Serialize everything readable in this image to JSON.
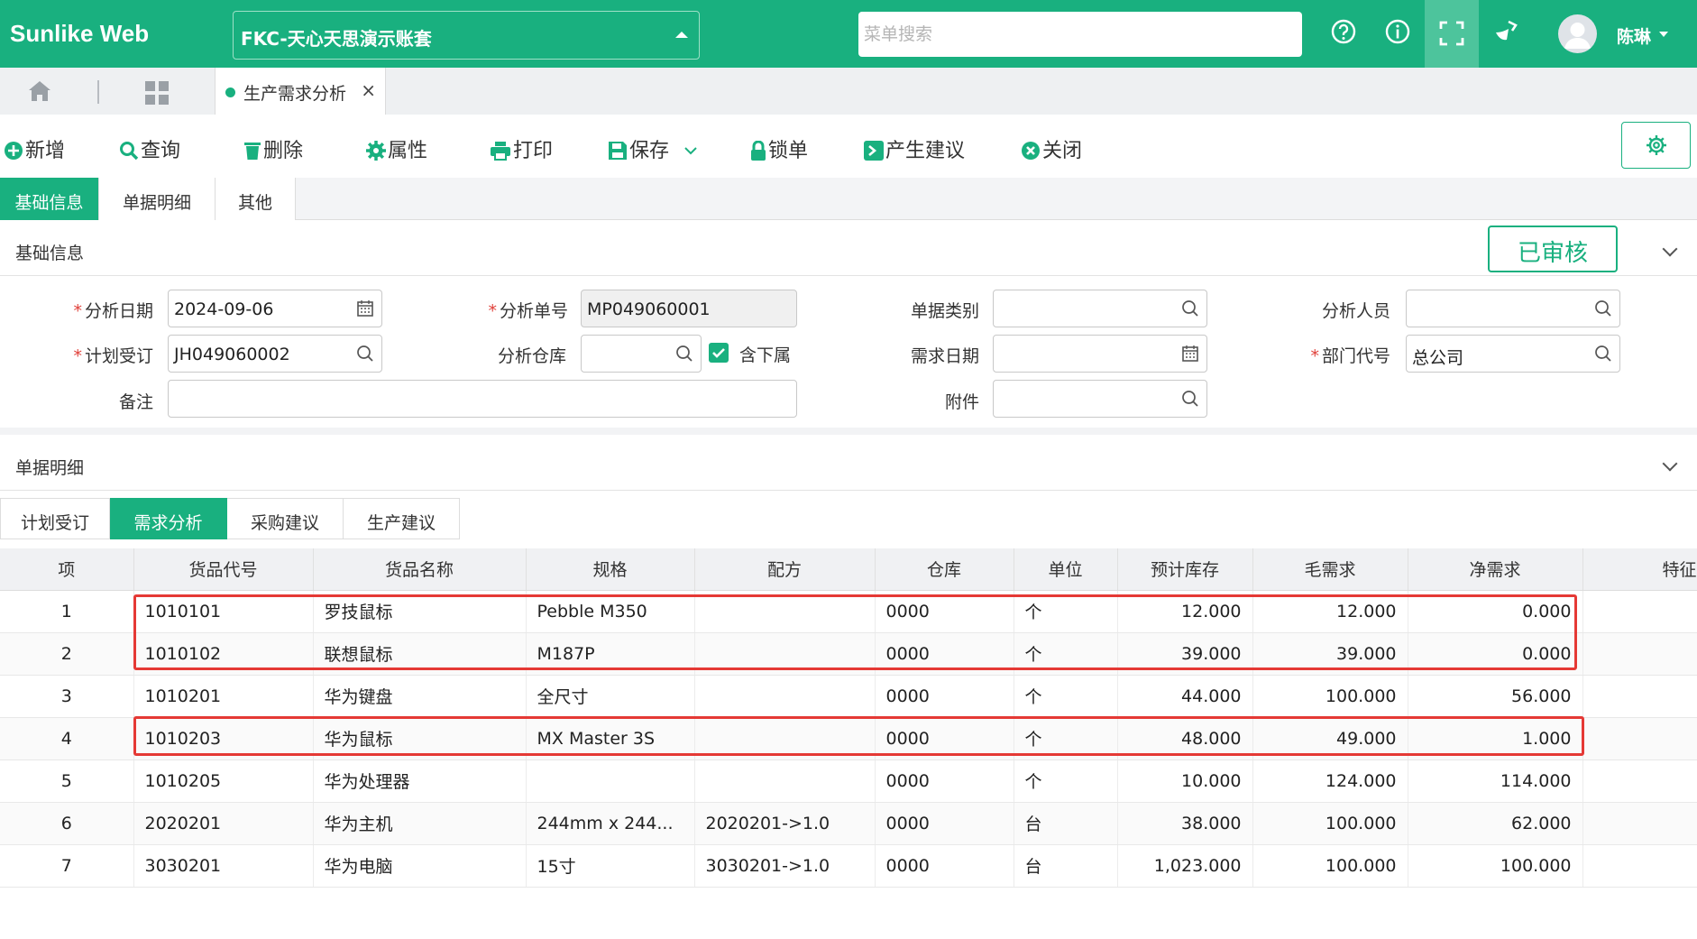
{
  "app": {
    "logo": "Sunlike Web",
    "account": "FKC-天心天思演示账套",
    "search_placeholder": "菜单搜索",
    "user": "陈琳"
  },
  "tabs": {
    "page_tab": "生产需求分析"
  },
  "toolbar": {
    "add": "新增",
    "query": "查询",
    "delete": "删除",
    "props": "属性",
    "print": "打印",
    "save": "保存",
    "lock": "锁单",
    "suggest": "产生建议",
    "close": "关闭"
  },
  "section_tabs": [
    "基础信息",
    "单据明细",
    "其他"
  ],
  "basic": {
    "title": "基础信息",
    "status": "已审核",
    "labels": {
      "date": "分析日期",
      "no": "分析单号",
      "type": "单据类别",
      "person": "分析人员",
      "plan": "计划受订",
      "wh": "分析仓库",
      "include_sub": "含下属",
      "req_date": "需求日期",
      "dept": "部门代号",
      "remark": "备注",
      "attach": "附件"
    },
    "values": {
      "date": "2024-09-06",
      "no": "MP049060001",
      "type": "",
      "person": "",
      "plan": "JH049060002",
      "wh": "",
      "req_date": "",
      "dept": "总公司",
      "remark": "",
      "attach": ""
    },
    "include_sub_checked": true
  },
  "detail": {
    "title": "单据明细",
    "tabs": [
      "计划受订",
      "需求分析",
      "采购建议",
      "生产建议"
    ],
    "active_tab": 1,
    "columns": [
      "项",
      "货品代号",
      "货品名称",
      "规格",
      "配方",
      "仓库",
      "单位",
      "预计库存",
      "毛需求",
      "净需求",
      "特征"
    ],
    "rows": [
      [
        "1",
        "1010101",
        "罗技鼠标",
        "Pebble M350",
        "",
        "0000",
        "个",
        "12.000",
        "12.000",
        "0.000",
        ""
      ],
      [
        "2",
        "1010102",
        "联想鼠标",
        "M187P",
        "",
        "0000",
        "个",
        "39.000",
        "39.000",
        "0.000",
        ""
      ],
      [
        "3",
        "1010201",
        "华为键盘",
        "全尺寸",
        "",
        "0000",
        "个",
        "44.000",
        "100.000",
        "56.000",
        ""
      ],
      [
        "4",
        "1010203",
        "华为鼠标",
        "MX Master 3S",
        "",
        "0000",
        "个",
        "48.000",
        "49.000",
        "1.000",
        ""
      ],
      [
        "5",
        "1010205",
        "华为处理器",
        "",
        "",
        "0000",
        "个",
        "10.000",
        "124.000",
        "114.000",
        ""
      ],
      [
        "6",
        "2020201",
        "华为主机",
        "244mm x 244...",
        "2020201->1.0",
        "0000",
        "台",
        "38.000",
        "100.000",
        "62.000",
        ""
      ],
      [
        "7",
        "3030201",
        "华为电脑",
        "15寸",
        "3030201->1.0",
        "0000",
        "台",
        "1,023.000",
        "100.000",
        "100.000",
        ""
      ]
    ]
  }
}
